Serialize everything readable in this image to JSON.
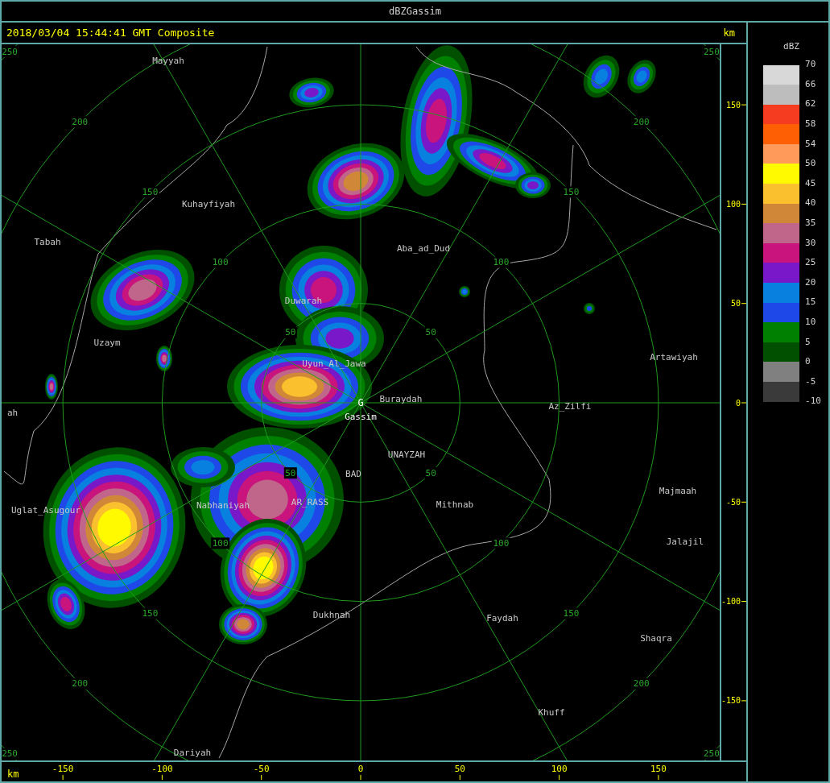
{
  "window": {
    "title": "dBZGassim"
  },
  "header": {
    "timestamp": "2018/03/04 15:44:41 GMT Composite",
    "y_unit": "km"
  },
  "map": {
    "site": {
      "marker": "G",
      "name": "Gassim"
    },
    "places": [
      "Mayyah",
      "Kuhayfiyah",
      "Tabah",
      "Aba_ad_Dud",
      "Duwarah",
      "Uzaym",
      "Uyun_Al_Jawa",
      "Buraydah",
      "ah",
      "Az_Zilfi",
      "Artawiyah",
      "UNAYZAH",
      "BAD",
      "Uglat_Asugour",
      "Nabhaniyah",
      "AR_RASS",
      "Mithnab",
      "Majmaah",
      "Jalajil",
      "Dukhnah",
      "Faydah",
      "Shaqra",
      "Khuff",
      "Dariyah"
    ],
    "range_rings": [
      {
        "labels": [
          "50",
          "50",
          "50",
          "50"
        ]
      },
      {
        "labels": [
          "100",
          "100",
          "100",
          "100"
        ]
      },
      {
        "labels": [
          "150",
          "150",
          "150",
          "150"
        ]
      },
      {
        "labels": [
          "200",
          "200",
          "200",
          "200"
        ]
      },
      {
        "labels": [
          "250",
          "250",
          "250",
          "250"
        ]
      }
    ]
  },
  "x_axis": {
    "unit": "km",
    "ticks": [
      "-150",
      "-100",
      "-50",
      "0",
      "50",
      "100",
      "150"
    ]
  },
  "y_axis": {
    "ticks": [
      "150",
      "100",
      "50",
      "0",
      "-50",
      "-100",
      "-150"
    ]
  },
  "legend": {
    "title": "dBZ",
    "labels": [
      "70",
      "66",
      "62",
      "58",
      "54",
      "50",
      "45",
      "40",
      "35",
      "30",
      "25",
      "20",
      "15",
      "10",
      "5",
      "0",
      "-5",
      "-10"
    ],
    "bins": [
      {
        "color": "#d8d8d8"
      },
      {
        "color": "#bdbdbd"
      },
      {
        "color": "#f63c20"
      },
      {
        "color": "#fe5f04"
      },
      {
        "color": "#ff9a5a"
      },
      {
        "color": "#fffa00"
      },
      {
        "color": "#fbc02d"
      },
      {
        "color": "#d08838"
      },
      {
        "color": "#c0668a"
      },
      {
        "color": "#c8147c"
      },
      {
        "color": "#7818c8"
      },
      {
        "color": "#0880e0"
      },
      {
        "color": "#1e48e8"
      },
      {
        "color": "#008000"
      },
      {
        "color": "#005000"
      },
      {
        "color": "#808080"
      },
      {
        "color": "#3a3a3a"
      }
    ]
  }
}
